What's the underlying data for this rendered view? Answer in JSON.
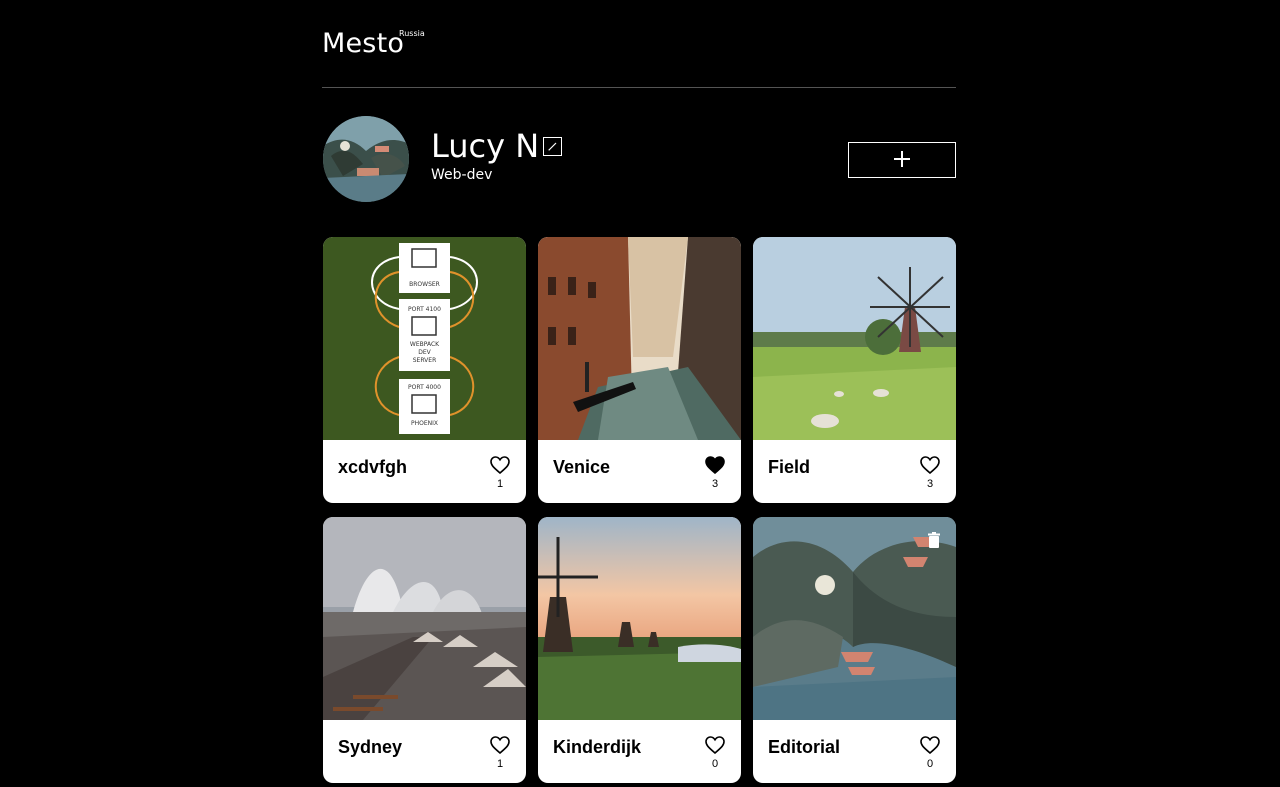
{
  "header": {
    "logo": "Mesto",
    "logo_sup": "Russia"
  },
  "profile": {
    "name": "Lucy N",
    "about": "Web-dev",
    "edit_icon": "pencil-icon",
    "add_icon": "plus-icon"
  },
  "colors": {
    "background": "#000000",
    "card": "#ffffff",
    "divider": "#545454"
  },
  "cards": [
    {
      "title": "xcdvfgh",
      "likes": "1",
      "liked": false
    },
    {
      "title": "Venice",
      "likes": "3",
      "liked": true
    },
    {
      "title": "Field",
      "likes": "3",
      "liked": false
    },
    {
      "title": "Sydney",
      "likes": "1",
      "liked": false
    },
    {
      "title": "Kinderdijk",
      "likes": "0",
      "liked": false
    },
    {
      "title": "Editorial",
      "likes": "0",
      "liked": false,
      "deletable": true
    }
  ],
  "diagram": {
    "browser": "BROWSER",
    "port1": "PORT 4100",
    "webpack_l1": "WEBPACK",
    "webpack_l2": "DEV",
    "webpack_l3": "SERVER",
    "port2": "PORT 4000",
    "phoenix": "PHOENIX"
  }
}
